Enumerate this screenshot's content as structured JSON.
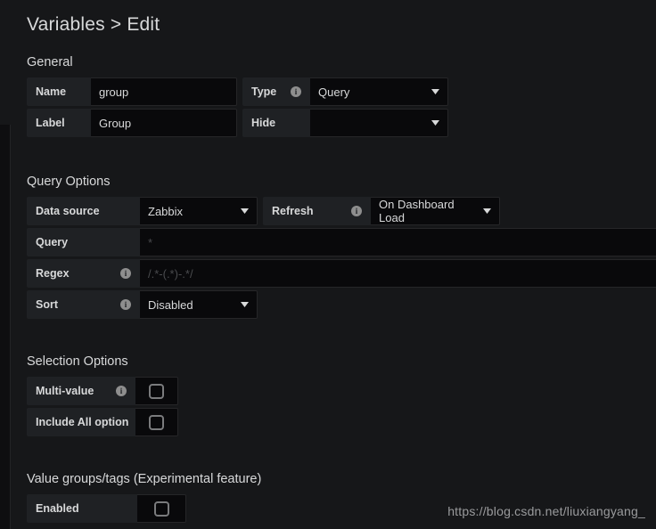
{
  "header": {
    "title": "Variables > Edit"
  },
  "general": {
    "section_title": "General",
    "name_label": "Name",
    "name_value": "group",
    "type_label": "Type",
    "type_value": "Query",
    "label_label": "Label",
    "label_value": "Group",
    "hide_label": "Hide",
    "hide_value": ""
  },
  "query_options": {
    "section_title": "Query Options",
    "datasource_label": "Data source",
    "datasource_value": "Zabbix",
    "refresh_label": "Refresh",
    "refresh_value": "On Dashboard Load",
    "query_label": "Query",
    "query_value": "*",
    "regex_label": "Regex",
    "regex_placeholder": "/.*-(.*)-.*/",
    "sort_label": "Sort",
    "sort_value": "Disabled"
  },
  "selection_options": {
    "section_title": "Selection Options",
    "multi_value_label": "Multi-value",
    "multi_value_checked": false,
    "include_all_label": "Include All option",
    "include_all_checked": false
  },
  "value_groups": {
    "section_title": "Value groups/tags (Experimental feature)",
    "enabled_label": "Enabled",
    "enabled_checked": false
  },
  "watermark": {
    "text": "https://blog.csdn.net/liuxiangyang_"
  },
  "colors": {
    "page_background": "#161719",
    "label_background": "#1f2124",
    "input_background": "#09090b",
    "text": "#d8d9da",
    "placeholder": "#5a5c60"
  }
}
